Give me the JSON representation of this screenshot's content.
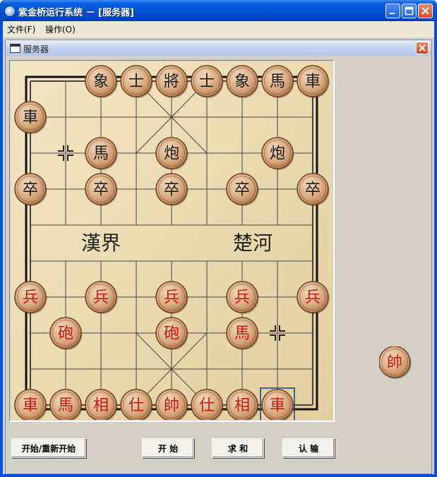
{
  "window": {
    "title": "紫金桥运行系统 － [服务器]"
  },
  "menu": [
    {
      "label": "文件(F)"
    },
    {
      "label": "操作(O)"
    }
  ],
  "child_window": {
    "title": "服务器"
  },
  "board": {
    "river_left": "漢界",
    "river_right": "楚河",
    "selected": {
      "col": 7,
      "row": 9
    },
    "markers": [
      {
        "col": 1,
        "row": 2
      },
      {
        "col": 7,
        "row": 7
      }
    ],
    "pieces": [
      {
        "char": "象",
        "side": "black",
        "col": 2,
        "row": 0
      },
      {
        "char": "士",
        "side": "black",
        "col": 3,
        "row": 0
      },
      {
        "char": "將",
        "side": "black",
        "col": 4,
        "row": 0
      },
      {
        "char": "士",
        "side": "black",
        "col": 5,
        "row": 0
      },
      {
        "char": "象",
        "side": "black",
        "col": 6,
        "row": 0
      },
      {
        "char": "馬",
        "side": "black",
        "col": 7,
        "row": 0
      },
      {
        "char": "車",
        "side": "black",
        "col": 8,
        "row": 0
      },
      {
        "char": "車",
        "side": "black",
        "col": 0,
        "row": 1
      },
      {
        "char": "馬",
        "side": "black",
        "col": 2,
        "row": 2
      },
      {
        "char": "炮",
        "side": "black",
        "col": 4,
        "row": 2
      },
      {
        "char": "炮",
        "side": "black",
        "col": 7,
        "row": 2
      },
      {
        "char": "卒",
        "side": "black",
        "col": 0,
        "row": 3
      },
      {
        "char": "卒",
        "side": "black",
        "col": 2,
        "row": 3
      },
      {
        "char": "卒",
        "side": "black",
        "col": 4,
        "row": 3
      },
      {
        "char": "卒",
        "side": "black",
        "col": 6,
        "row": 3
      },
      {
        "char": "卒",
        "side": "black",
        "col": 8,
        "row": 3
      },
      {
        "char": "兵",
        "side": "red",
        "col": 0,
        "row": 6
      },
      {
        "char": "兵",
        "side": "red",
        "col": 2,
        "row": 6
      },
      {
        "char": "兵",
        "side": "red",
        "col": 4,
        "row": 6
      },
      {
        "char": "兵",
        "side": "red",
        "col": 6,
        "row": 6
      },
      {
        "char": "兵",
        "side": "red",
        "col": 8,
        "row": 6
      },
      {
        "char": "砲",
        "side": "red",
        "col": 1,
        "row": 7
      },
      {
        "char": "砲",
        "side": "red",
        "col": 4,
        "row": 7
      },
      {
        "char": "馬",
        "side": "red",
        "col": 6,
        "row": 7
      },
      {
        "char": "車",
        "side": "red",
        "col": 0,
        "row": 9
      },
      {
        "char": "馬",
        "side": "red",
        "col": 1,
        "row": 9
      },
      {
        "char": "相",
        "side": "red",
        "col": 2,
        "row": 9
      },
      {
        "char": "仕",
        "side": "red",
        "col": 3,
        "row": 9
      },
      {
        "char": "帥",
        "side": "red",
        "col": 4,
        "row": 9
      },
      {
        "char": "仕",
        "side": "red",
        "col": 5,
        "row": 9
      },
      {
        "char": "相",
        "side": "red",
        "col": 6,
        "row": 9
      },
      {
        "char": "車",
        "side": "red",
        "col": 7,
        "row": 9
      }
    ]
  },
  "side_piece": {
    "char": "帥",
    "side": "red"
  },
  "buttons": {
    "start_restart": "开始/重新开始",
    "start": "开 始",
    "draw": "求 和",
    "resign": "认 输"
  },
  "colors": {
    "black_text": "#1a1a1a",
    "red_text": "#c81414",
    "board": "#ecdcb4"
  }
}
